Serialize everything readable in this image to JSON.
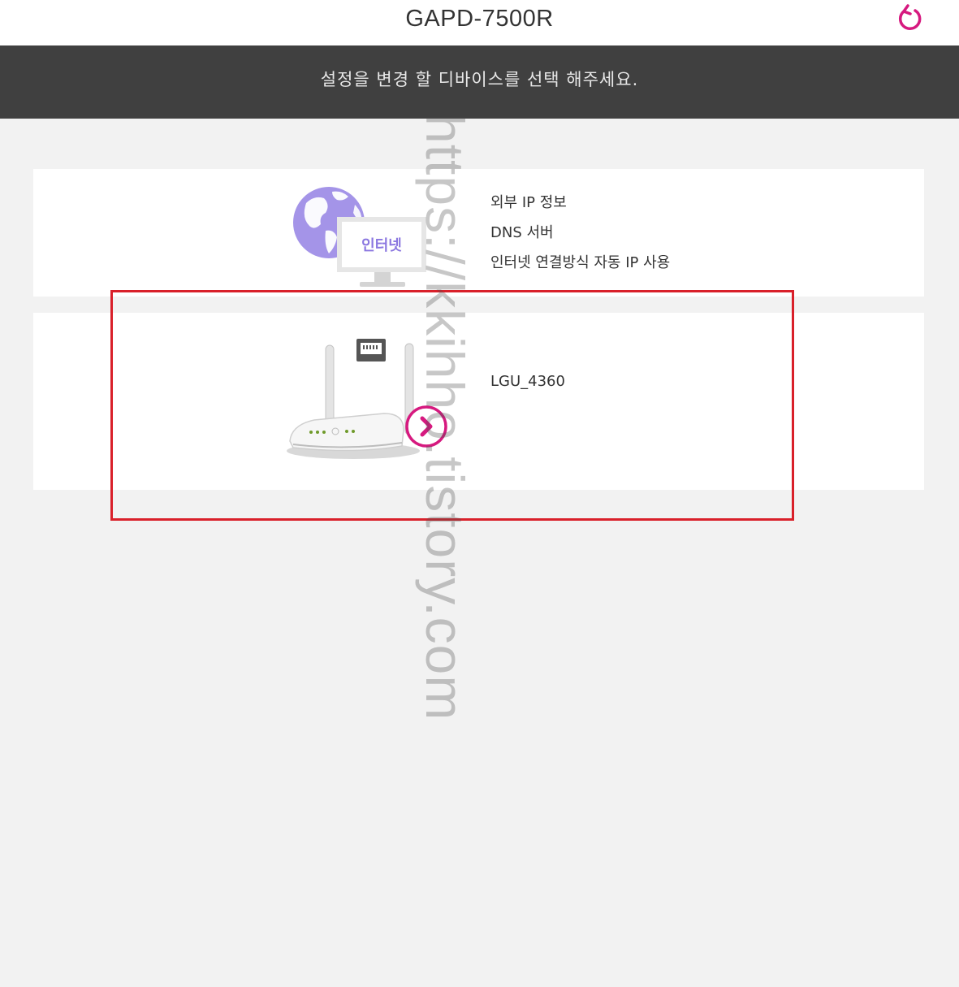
{
  "header": {
    "title": "GAPD-7500R",
    "refresh_icon": "refresh-icon"
  },
  "banner": {
    "text": "설정을 변경 할 디바이스를 선택 해주세요."
  },
  "internet_card": {
    "icon_label": "인터넷",
    "icon": "globe-monitor-icon",
    "lines": [
      "외부 IP 정보",
      "DNS 서버",
      "인터넷 연결방식 자동 IP 사용"
    ]
  },
  "router_card": {
    "icon": "router-icon",
    "next_icon": "chevron-right-icon",
    "name": "LGU_4360"
  },
  "watermark": {
    "text": "https://kkihho.tistory.com"
  },
  "colors": {
    "accent": "#d6197f",
    "banner_bg": "#404040",
    "highlight_border": "#d9202a",
    "globe": "#a494e8",
    "page_bg": "#f2f2f2"
  }
}
